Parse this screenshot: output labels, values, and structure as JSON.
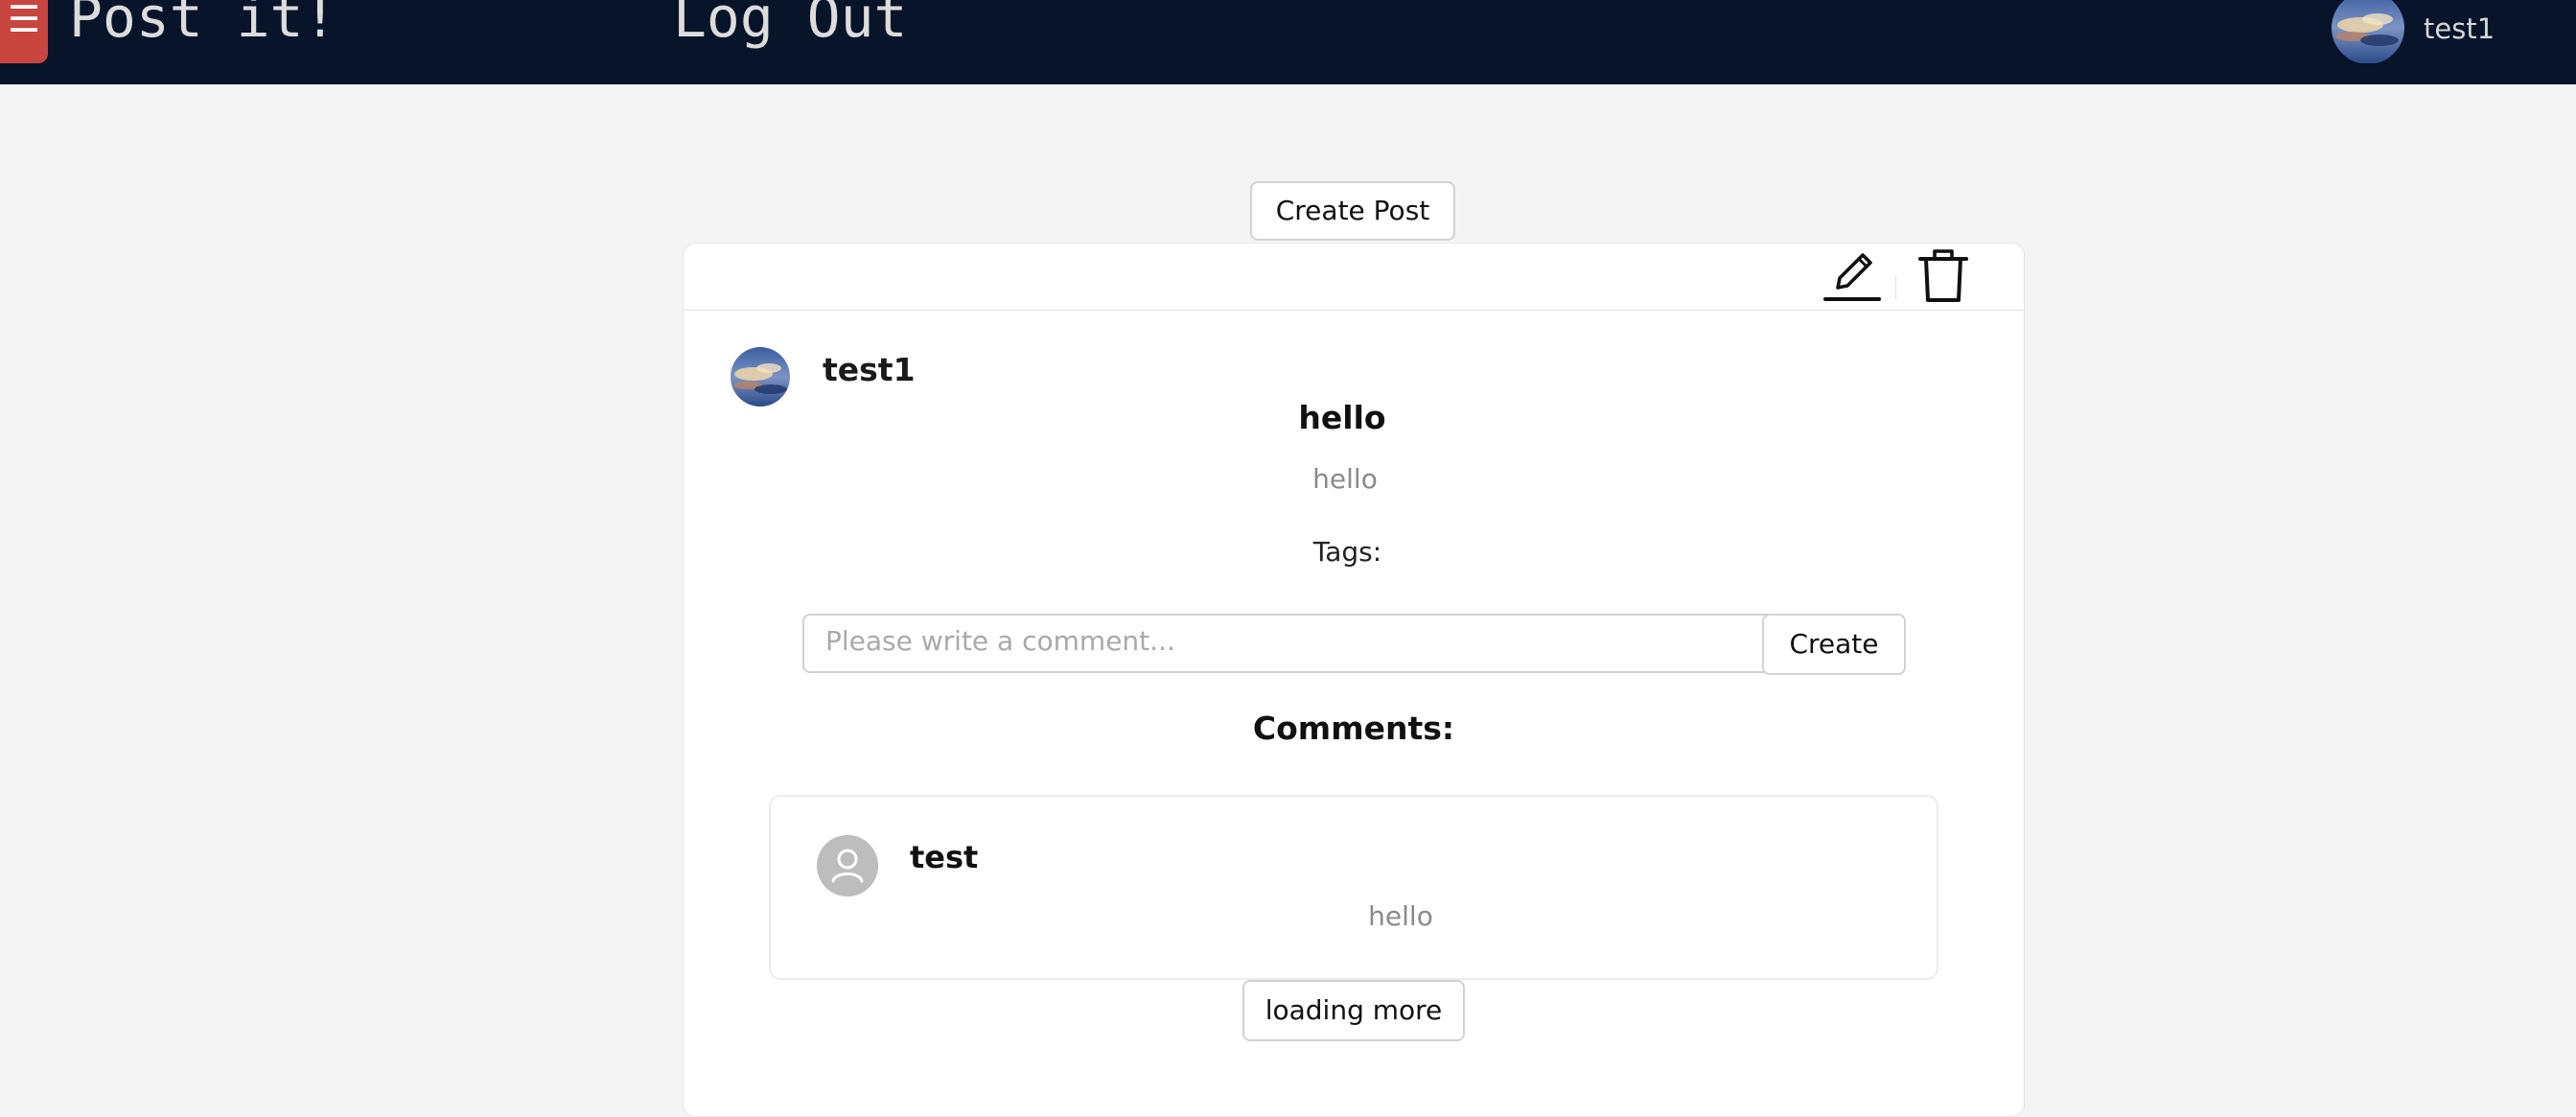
{
  "navbar": {
    "menu_icon": "hamburger-icon",
    "brand": "Post it!",
    "logout": "Log Out",
    "user_name": "test1",
    "accent": "#c9453f",
    "background": "#07142a"
  },
  "main": {
    "create_post_label": "Create Post"
  },
  "post": {
    "edit_icon": "pencil-icon",
    "delete_icon": "trash-icon",
    "author": "test1",
    "title": "hello",
    "body": "hello",
    "tags_label": "Tags:",
    "comment_placeholder": "Please write a comment...",
    "comment_value": "",
    "create_comment_label": "Create",
    "comments_heading": "Comments:",
    "comments": [
      {
        "author": "test",
        "text": "hello",
        "avatar_icon": "user-icon"
      }
    ],
    "loading_more_label": "loading more"
  }
}
